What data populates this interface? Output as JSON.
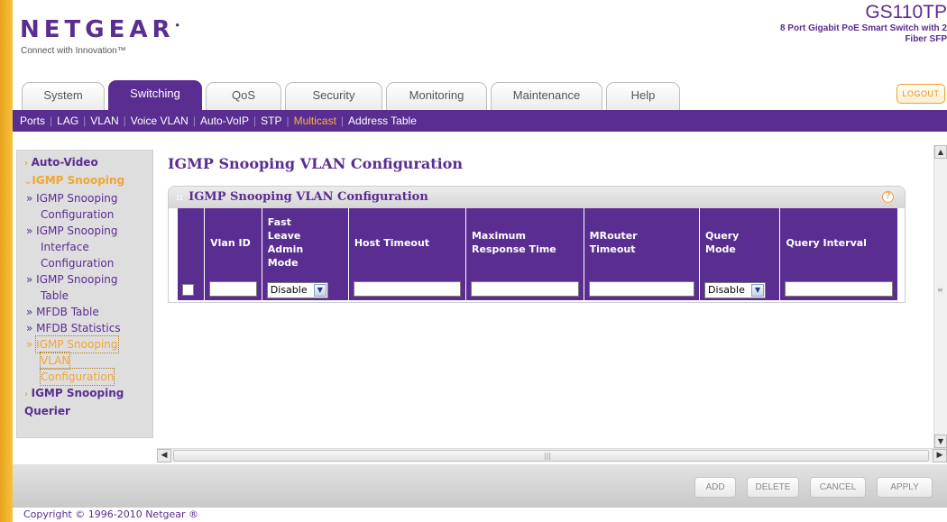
{
  "brand": {
    "logo": "NETGEAR",
    "tagline": "Connect with Innovation™",
    "model": "GS110TP",
    "model_desc": "8 Port Gigabit PoE Smart Switch with 2 Fiber SFP"
  },
  "tabs": [
    {
      "label": "System",
      "active": false
    },
    {
      "label": "Switching",
      "active": true
    },
    {
      "label": "QoS",
      "active": false
    },
    {
      "label": "Security",
      "active": false
    },
    {
      "label": "Monitoring",
      "active": false
    },
    {
      "label": "Maintenance",
      "active": false
    },
    {
      "label": "Help",
      "active": false
    }
  ],
  "logout_label": "LOGOUT",
  "subnav": [
    "Ports",
    "LAG",
    "VLAN",
    "Voice VLAN",
    "Auto-VoIP",
    "STP",
    "Multicast",
    "Address Table"
  ],
  "subnav_active": "Multicast",
  "leftnav": {
    "auto_video": "Auto-Video",
    "igmp_snooping": "IGMP Snooping",
    "items": [
      {
        "prefix": "»",
        "line1": "IGMP Snooping",
        "line2": "Configuration",
        "line3": ""
      },
      {
        "prefix": "»",
        "line1": "IGMP Snooping",
        "line2": "Interface",
        "line3": "Configuration"
      },
      {
        "prefix": "»",
        "line1": "IGMP Snooping",
        "line2": "Table",
        "line3": ""
      },
      {
        "prefix": "»",
        "line1": "MFDB Table",
        "line2": "",
        "line3": ""
      },
      {
        "prefix": "»",
        "line1": "MFDB Statistics",
        "line2": "",
        "line3": ""
      },
      {
        "prefix": "»",
        "line1": "IGMP Snooping",
        "line2": "VLAN",
        "line3": "Configuration"
      }
    ],
    "querier_1": "IGMP Snooping",
    "querier_2": "Querier"
  },
  "main": {
    "page_title": "IGMP Snooping VLAN Configuration",
    "panel_title": "IGMP Snooping VLAN Configuration",
    "columns": {
      "vlan_id": "Vlan ID",
      "fast_leave": [
        "Fast",
        "Leave",
        "Admin",
        "Mode"
      ],
      "host_timeout": "Host Timeout",
      "max_response": [
        "Maximum",
        "Response Time"
      ],
      "mrouter": [
        "MRouter",
        "Timeout"
      ],
      "query_mode": [
        "Query",
        "Mode"
      ],
      "query_interval": "Query Interval"
    },
    "row": {
      "fast_leave_value": "Disable",
      "query_mode_value": "Disable"
    }
  },
  "buttons": {
    "add": "ADD",
    "delete": "DELETE",
    "cancel": "CANCEL",
    "apply": "APPLY"
  },
  "copyright": "Copyright © 1996-2010 Netgear ®"
}
